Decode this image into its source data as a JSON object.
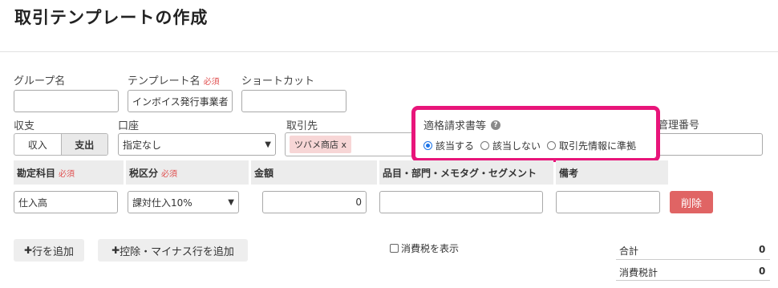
{
  "page": {
    "title": "取引テンプレートの作成"
  },
  "form": {
    "group_label": "グループ名",
    "group_value": "",
    "template_label": "テンプレート名",
    "required": "必須",
    "template_value": "インボイス発行事業者",
    "shortcut_label": "ショートカット",
    "shortcut_value": "",
    "income_expense_label": "収支",
    "income": "収入",
    "expense": "支出",
    "account_label": "口座",
    "account_value": "指定なし",
    "partner_label": "取引先",
    "partner_tag": "ツバメ商店",
    "partner_tag_remove": "x",
    "invoice_label": "適格請求書等",
    "invoice_help": "?",
    "invoice_options": [
      "該当する",
      "該当しない",
      "取引先情報に準拠"
    ],
    "invoice_selected": "該当する",
    "mgmt_label": "管理番号",
    "mgmt_value": ""
  },
  "table": {
    "headers": {
      "account": "勘定科目",
      "tax": "税区分",
      "amount": "金額",
      "item": "品目・部門・メモタグ・セグメント",
      "note": "備考"
    },
    "required": "必須",
    "row": {
      "account": "仕入高",
      "tax": "課対仕入10%",
      "amount": "0",
      "item": "",
      "note": "",
      "delete": "削除"
    }
  },
  "actions": {
    "add_row": "行を追加",
    "add_deduction": "控除・マイナス行を追加",
    "plus": "✚",
    "show_tax": "消費税を表示"
  },
  "summary": {
    "total_label": "合計",
    "total_value": "0",
    "tax_label": "消費税計",
    "tax_value": "0"
  },
  "colors": {
    "highlight": "#e8157a",
    "required": "#e05050",
    "delete_button": "#e06464",
    "radio_selected": "#1a73e8"
  }
}
